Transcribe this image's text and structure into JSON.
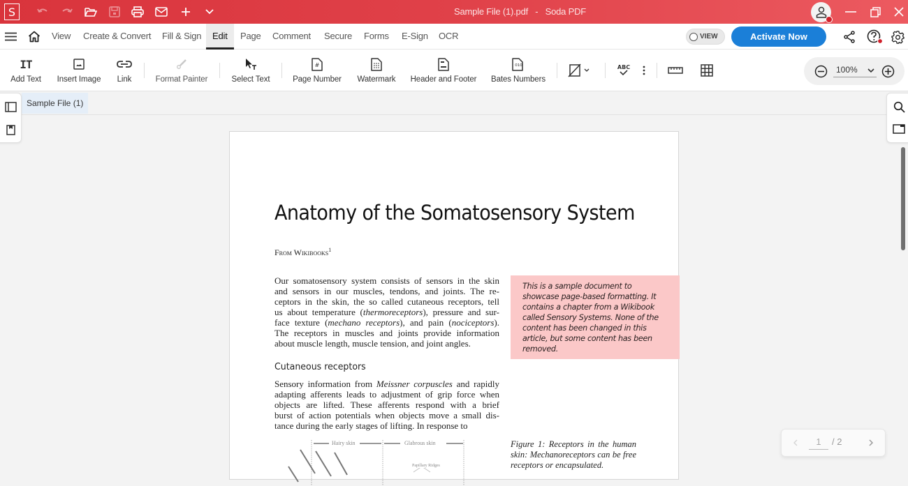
{
  "titlebar": {
    "app_logo": "S",
    "title": "Sample File (1).pdf   -   Soda PDF",
    "icons": [
      "undo-icon",
      "redo-icon",
      "open-folder-icon",
      "save-icon",
      "print-icon",
      "email-icon",
      "new-icon",
      "quick-access-dropdown-icon"
    ]
  },
  "menubar": {
    "items": [
      {
        "label": "View"
      },
      {
        "label": "Create & Convert"
      },
      {
        "label": "Fill & Sign"
      },
      {
        "label": "Edit",
        "active": true
      },
      {
        "label": "Page"
      },
      {
        "label": "Comment"
      },
      {
        "label": "Secure"
      },
      {
        "label": "Forms"
      },
      {
        "label": "E-Sign"
      },
      {
        "label": "OCR"
      }
    ],
    "view_toggle": "VIEW",
    "activate_button": "Activate Now",
    "accent_color": "#1b7fd8"
  },
  "toolbar": {
    "tools": [
      {
        "label": "Add Text",
        "icon": "add-text-icon"
      },
      {
        "label": "Insert Image",
        "icon": "insert-image-icon"
      },
      {
        "label": "Link",
        "icon": "link-icon"
      },
      {
        "label": "Format Painter",
        "icon": "format-painter-icon",
        "disabled": true
      },
      {
        "label": "Select Text",
        "icon": "select-text-icon"
      },
      {
        "label": "Page Number",
        "icon": "page-number-icon"
      },
      {
        "label": "Watermark",
        "icon": "watermark-icon"
      },
      {
        "label": "Header and Footer",
        "icon": "header-footer-icon"
      },
      {
        "label": "Bates Numbers",
        "icon": "bates-numbers-icon"
      }
    ],
    "bates_glyph": "010",
    "spell_glyph": "ABC",
    "zoom_level": "100%"
  },
  "document": {
    "tab_label": "Sample File (1)",
    "title": "Anatomy of the Somatosensory System",
    "from": "From Wikibooks",
    "from_sup": "1",
    "para1": [
      "Our somatosensory system consists of sensors in the skin",
      "and sensors in our muscles, tendons, and joints. The re-",
      "ceptors in the skin, the so called cutaneous receptors, tell",
      "us about temperature (|thermoreceptors|), pressure and sur-",
      "face texture (|mechano receptors|), and pain (|nociceptors|).",
      "The receptors in muscles and joints provide information",
      "about muscle length, muscle tension, and joint angles."
    ],
    "heading2": "Cutaneous receptors",
    "para2": [
      "Sensory information from |Meissner corpuscles| and rapidly",
      "adapting afferents leads to adjustment of grip force when",
      "objects are lifted. These afferents respond with a brief",
      "burst of action potentials when objects move a small dis-",
      "tance during the early stages of lifting. In response to"
    ],
    "note": "This is a sample document to showcase page-based formatting. It contains a chapter from a Wikibook called Sensory Systems. None of the content has been changed in this article, but some content has been removed.",
    "note_color": "#fbc8c8",
    "figure_labels": {
      "hairy": "Hairy skin",
      "glabrous": "Glabrous skin",
      "papillary": "Papillary Ridges"
    },
    "figure_caption": "Figure 1:  Receptors in the human skin: Mechanoreceptors can be free receptors or encapsulated."
  },
  "pager": {
    "current_page": "1",
    "total": "/ 2"
  }
}
